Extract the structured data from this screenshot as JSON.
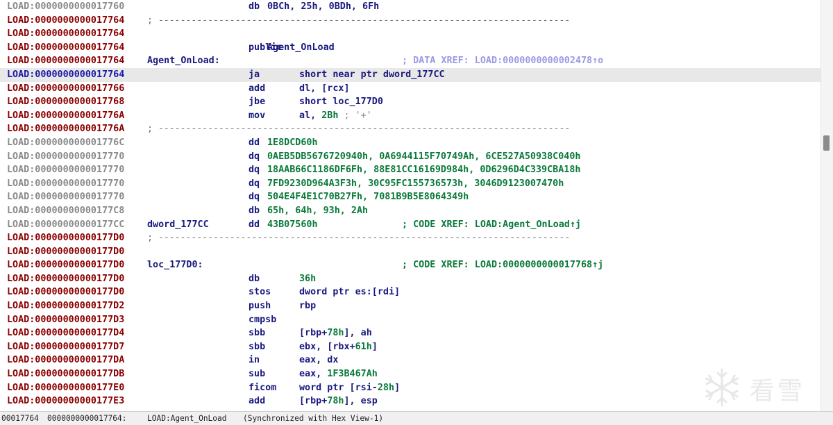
{
  "listing": {
    "rows": [
      {
        "addr": "LOAD:0000000000017760",
        "addr_style": "data",
        "mnem": "db",
        "ops_db": "0BCh, 25h, 0BDh, 6Fh"
      },
      {
        "addr": "LOAD:0000000000017764",
        "addr_style": "code",
        "sep": "; ---------------------------------------------------------------------------"
      },
      {
        "addr": "LOAD:0000000000017764",
        "addr_style": "code"
      },
      {
        "addr": "LOAD:0000000000017764",
        "addr_style": "code",
        "mnem": "public",
        "ops_db": "Agent_OnLoad"
      },
      {
        "addr": "LOAD:0000000000017764",
        "addr_style": "code",
        "label": "Agent_OnLoad:",
        "xref_data": "; DATA XREF: LOAD:0000000000002478↑o"
      },
      {
        "addr": "LOAD:0000000000017764",
        "addr_style": "cur",
        "selected": true,
        "mnem": "ja",
        "ops": "short near ptr dword_177CC"
      },
      {
        "addr": "LOAD:0000000000017766",
        "addr_style": "code",
        "mnem": "add",
        "ops": "dl, [rcx]"
      },
      {
        "addr": "LOAD:0000000000017768",
        "addr_style": "code",
        "mnem": "jbe",
        "ops": "short loc_177D0"
      },
      {
        "addr": "LOAD:000000000001776A",
        "addr_style": "code",
        "mnem": "mov",
        "ops": "al, ",
        "ops_num": "2Bh",
        "ops_cmt": " ; '+'"
      },
      {
        "addr": "LOAD:000000000001776A",
        "addr_style": "code",
        "sep": "; ---------------------------------------------------------------------------"
      },
      {
        "addr": "LOAD:000000000001776C",
        "addr_style": "data",
        "mnem": "dd",
        "ops_wide": "1E8DCD60h"
      },
      {
        "addr": "LOAD:0000000000017770",
        "addr_style": "data",
        "mnem": "dq",
        "ops_wide": "0AEB5DB5676720940h, 0A6944115F70749Ah, 6CE527A50938C040h"
      },
      {
        "addr": "LOAD:0000000000017770",
        "addr_style": "data",
        "mnem": "dq",
        "ops_wide": "18AAB66C1186DF6Fh, 88E81CC16169D984h, 0D6296D4C339CBA18h"
      },
      {
        "addr": "LOAD:0000000000017770",
        "addr_style": "data",
        "mnem": "dq",
        "ops_wide": "7FD9230D964A3F3h, 30C95FC155736573h, 3046D9123007470h"
      },
      {
        "addr": "LOAD:0000000000017770",
        "addr_style": "data",
        "mnem": "dq",
        "ops_wide": "504E4F4E1C70B27Fh, 7081B9B5E8064349h"
      },
      {
        "addr": "LOAD:00000000000177C8",
        "addr_style": "data",
        "mnem": "db",
        "ops_wide": "65h, 64h, 93h, 2Ah"
      },
      {
        "addr": "LOAD:00000000000177CC",
        "addr_style": "data",
        "label": "dword_177CC",
        "mnem": "dd",
        "ops_wide": "43B07560h",
        "xref_code": "; CODE XREF: LOAD:Agent_OnLoad↑j"
      },
      {
        "addr": "LOAD:00000000000177D0",
        "addr_style": "code",
        "sep": "; ---------------------------------------------------------------------------"
      },
      {
        "addr": "LOAD:00000000000177D0",
        "addr_style": "code"
      },
      {
        "addr": "LOAD:00000000000177D0",
        "addr_style": "code",
        "label": "loc_177D0:",
        "xref_code": "; CODE XREF: LOAD:0000000000017768↑j"
      },
      {
        "addr": "LOAD:00000000000177D0",
        "addr_style": "code",
        "mnem": "db",
        "ops_num_only": "36h"
      },
      {
        "addr": "LOAD:00000000000177D0",
        "addr_style": "code",
        "mnem": "stos",
        "ops": "dword ptr es:[rdi]"
      },
      {
        "addr": "LOAD:00000000000177D2",
        "addr_style": "code",
        "mnem": "push",
        "ops": "rbp"
      },
      {
        "addr": "LOAD:00000000000177D3",
        "addr_style": "code",
        "mnem": "cmpsb"
      },
      {
        "addr": "LOAD:00000000000177D4",
        "addr_style": "code",
        "mnem": "sbb",
        "ops": "[rbp+",
        "ops_num": "78h",
        "ops_tail": "], ah"
      },
      {
        "addr": "LOAD:00000000000177D7",
        "addr_style": "code",
        "mnem": "sbb",
        "ops": "ebx, [rbx+",
        "ops_num": "61h",
        "ops_tail": "]"
      },
      {
        "addr": "LOAD:00000000000177DA",
        "addr_style": "code",
        "mnem": "in",
        "ops": "eax, dx"
      },
      {
        "addr": "LOAD:00000000000177DB",
        "addr_style": "code",
        "mnem": "sub",
        "ops": "eax, ",
        "ops_num": "1F3B467Ah"
      },
      {
        "addr": "LOAD:00000000000177E0",
        "addr_style": "code",
        "mnem": "ficom",
        "ops": "word ptr [rsi-",
        "ops_num": "28h",
        "ops_tail": "]"
      },
      {
        "addr": "LOAD:00000000000177E3",
        "addr_style": "code",
        "mnem": "add",
        "ops": "[rbp+",
        "ops_num": "78h",
        "ops_tail": "], esp"
      }
    ]
  },
  "statusbar": {
    "offset": "00017764",
    "address": "0000000000017764:",
    "location": "LOAD:Agent_OnLoad",
    "sync": "(Synchronized with Hex View-1)"
  },
  "watermark": {
    "text": "看雪",
    "icon": "snowflake-icon"
  },
  "colors": {
    "addr_data": "#8a8a8a",
    "addr_code": "#8b0000",
    "addr_current": "#1a1aa6",
    "instruction": "#1a1a80",
    "number": "#0a7a3a",
    "xref_data": "#9a9ae6",
    "selection": "#e8e8e8"
  }
}
